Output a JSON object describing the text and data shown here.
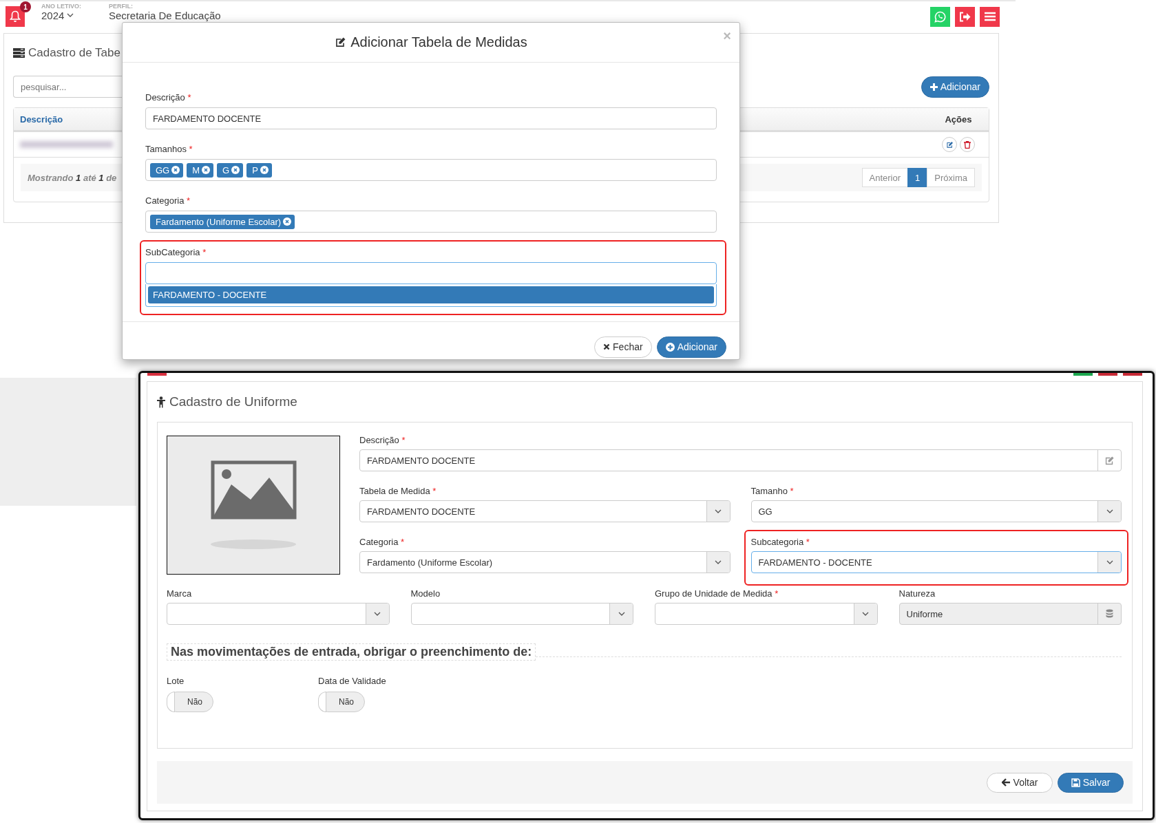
{
  "header": {
    "notification_count": "1",
    "year_label": "ANO LETIVO:",
    "year": "2024",
    "profile_label": "PERFIL:",
    "profile": "Secretaria De Educação"
  },
  "background_page": {
    "title": "Cadastro de Tabe",
    "search": {
      "placeholder": "pesquisar..."
    },
    "add_button": "Adicionar",
    "table": {
      "columns": [
        "Descrição",
        "Ações"
      ]
    },
    "footer": {
      "summary": "Mostrando **1** até **1** de",
      "pagination": [
        {
          "label": "Anterior",
          "selected": false
        },
        {
          "label": "1",
          "selected": true
        },
        {
          "label": "Próxima",
          "selected": false
        }
      ]
    }
  },
  "modal": {
    "title": "Adicionar Tabela de Medidas",
    "close": "×",
    "fields": [
      {
        "kind": "text",
        "label": "Descrição",
        "required_mark": "*",
        "value": "FARDAMENTO DOCENTE",
        "highlighted": false,
        "focused": false
      },
      {
        "kind": "tags",
        "label": "Tamanhos",
        "required_mark": "*",
        "tags": [
          "GG",
          "M",
          "G",
          "P"
        ],
        "highlighted": false,
        "focused": false
      },
      {
        "kind": "tags",
        "label": "Categoria",
        "required_mark": "*",
        "tags": [
          "Fardamento (Uniforme Escolar)"
        ],
        "highlighted": false,
        "focused": false
      },
      {
        "kind": "search",
        "label": "SubCategoria",
        "required_mark": "*",
        "highlighted": true,
        "focused": true,
        "options": [
          {
            "label": "FARDAMENTO - DOCENTE",
            "selected": true
          }
        ]
      }
    ],
    "buttons": [
      {
        "kind": "default",
        "label": "Fechar"
      },
      {
        "kind": "primary",
        "label": "Adicionar"
      }
    ]
  },
  "uniform_form": {
    "title": "Cadastro de Uniforme",
    "main_field": {
      "kind": "text",
      "label": "Descrição",
      "required_mark": "*",
      "value": "FARDAMENTO DOCENTE",
      "highlighted": false,
      "focused": false
    },
    "pair_fields": [
      {
        "kind": "select",
        "label": "Tabela de Medida",
        "required_mark": "*",
        "value": "FARDAMENTO DOCENTE",
        "highlighted": false,
        "focused": false
      },
      {
        "kind": "select",
        "label": "Tamanho",
        "required_mark": "*",
        "value": "GG",
        "highlighted": false,
        "focused": false
      },
      {
        "kind": "select",
        "label": "Categoria",
        "required_mark": "*",
        "value": "Fardamento (Uniforme Escolar)",
        "highlighted": false,
        "focused": false
      },
      {
        "kind": "select",
        "label": "Subcategoria",
        "required_mark": "*",
        "value": "FARDAMENTO - DOCENTE",
        "highlighted": true,
        "focused": true
      }
    ],
    "bottom_fields": [
      {
        "kind": "select",
        "label": "Marca",
        "highlighted": false,
        "focused": false
      },
      {
        "kind": "select",
        "label": "Modelo",
        "highlighted": false,
        "focused": false
      },
      {
        "kind": "select",
        "label": "Grupo de Unidade de Medida",
        "required_mark": "*",
        "highlighted": false,
        "focused": false
      },
      {
        "kind": "readonly",
        "label": "Natureza",
        "value": "Uniforme",
        "highlighted": false,
        "focused": false
      }
    ],
    "section_heading": "Nas movimentações de entrada, obrigar o preenchimento de:",
    "toggles": [
      {
        "label": "Lote",
        "on": false,
        "text": "Não"
      },
      {
        "label": "Data de Validade",
        "on": false,
        "text": "Não"
      }
    ],
    "buttons": [
      {
        "kind": "default",
        "label": "Voltar"
      },
      {
        "kind": "primary",
        "label": "Salvar"
      }
    ]
  }
}
